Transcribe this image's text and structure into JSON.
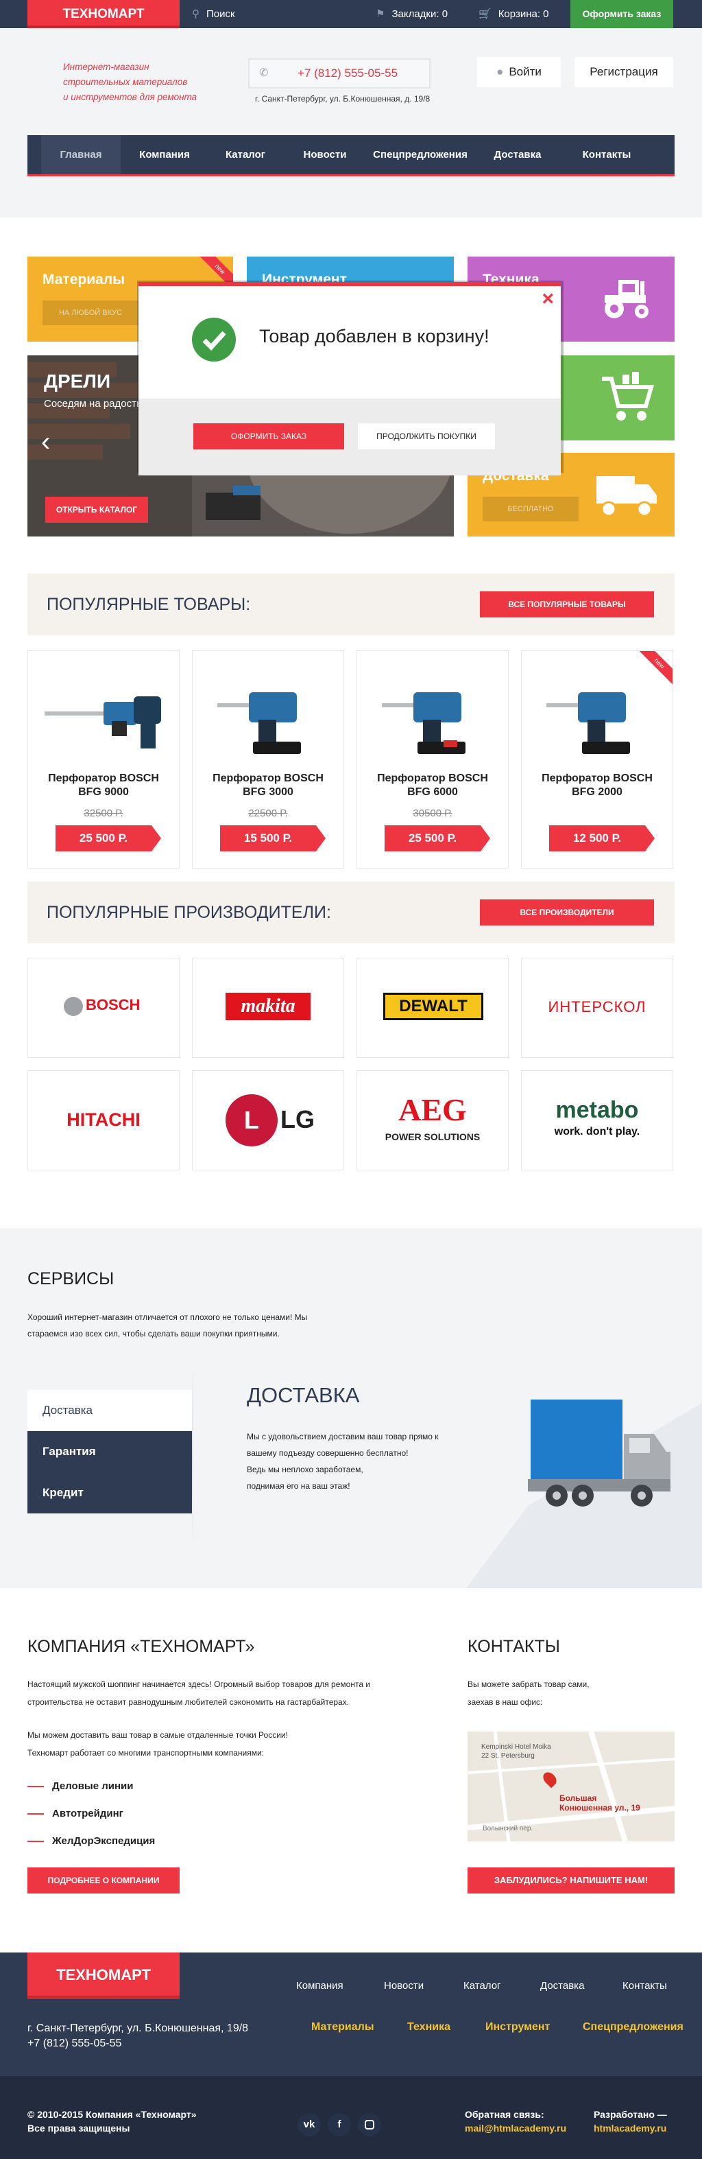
{
  "topbar": {
    "logo": "ТЕХНОМАРТ",
    "search": "Поиск",
    "bookmarks": "Закладки: 0",
    "cart": "Корзина: 0",
    "order": "Оформить заказ"
  },
  "header": {
    "slogan": [
      "Интернет-магазин",
      "строительных материалов",
      "и инструментов для ремонта"
    ],
    "phone": "+7 (812) 555-05-55",
    "address": "г. Санкт-Петербург, ул. Б.Конюшенная, д. 19/8",
    "login": "Войти",
    "register": "Регистрация"
  },
  "nav": [
    "Главная",
    "Компания",
    "Каталог",
    "Новости",
    "Спецпредложения",
    "Доставка",
    "Контакты"
  ],
  "tiles": {
    "materials": {
      "title": "Материалы",
      "button": "НА ЛЮБОЙ ВКУС",
      "ribbon": "new"
    },
    "instruments": {
      "title": "Инструмент"
    },
    "tech": {
      "title": "Техника"
    },
    "delivery": {
      "title": "Доставка",
      "button": "БЕСПЛАТНО"
    },
    "slider": {
      "title": "ДРЕЛИ",
      "subtitle": "Соседям на радость!",
      "button": "ОТКРЫТЬ КАТАЛОГ"
    }
  },
  "modal": {
    "message": "Товар добавлен в корзину!",
    "checkout": "ОФОРМИТЬ ЗАКАЗ",
    "continue": "ПРОДОЛЖИТЬ ПОКУПКИ"
  },
  "popular": {
    "title": "ПОПУЛЯРНЫЕ ТОВАРЫ:",
    "button": "ВСЕ ПОПУЛЯРНЫЕ ТОВАРЫ",
    "products": [
      {
        "name1": "Перфоратор BOSCH",
        "name2": "BFG 9000",
        "old": "32500 Р.",
        "price": "25 500 Р."
      },
      {
        "name1": "Перфоратор BOSCH",
        "name2": "BFG 3000",
        "old": "22500 Р.",
        "price": "15 500 Р."
      },
      {
        "name1": "Перфоратор BOSCH",
        "name2": "BFG 6000",
        "old": "30500 Р.",
        "price": "25 500 Р."
      },
      {
        "name1": "Перфоратор BOSCH",
        "name2": "BFG 2000",
        "old": "",
        "price": "12 500 Р.",
        "ribbon": "new"
      }
    ]
  },
  "brands": {
    "title": "ПОПУЛЯРНЫЕ ПРОИЗВОДИТЕЛИ:",
    "button": "ВСЕ ПРОИЗВОДИТЕЛИ",
    "items": [
      "BOSCH",
      "makita",
      "DEWALT",
      "ИНТЕРСКОЛ",
      "HITACHI",
      "LG",
      "AEG",
      "POWER SOLUTIONS",
      "metabo",
      "work. don't play."
    ]
  },
  "services": {
    "title": "СЕРВИСЫ",
    "text1": "Хороший интернет-магазин отличается от плохого не только ценами! Мы",
    "text2": "стараемся изо всех сил, чтобы сделать ваши покупки приятными.",
    "tabs": [
      "Доставка",
      "Гарантия",
      "Кредит"
    ],
    "delivery_title": "ДОСТАВКА",
    "delivery_text": [
      "Мы с удовольствием доставим ваш товар прямо к",
      "вашему подъезду совершенно бесплатно!",
      "Ведь мы неплохо заработаем,",
      "поднимая его на ваш этаж!"
    ]
  },
  "company": {
    "title": "КОМПАНИЯ «ТЕХНОМАРТ»",
    "p1": [
      "Настоящий мужской шоппинг начинается здесь! Огромный выбор товаров для ремонта и",
      "строительства не оставит равнодушным любителей сэкономить на гастарбайтерах."
    ],
    "p2": [
      "Мы можем доставить ваш товар в самые отдаленные точки России!",
      "Техномарт работает со многими транспортными компаниями:"
    ],
    "list": [
      "Деловые линии",
      "Автотрейдинг",
      "ЖелДорЭкспедиция"
    ],
    "button": "ПОДРОБНЕЕ О КОМПАНИИ"
  },
  "contacts": {
    "title": "КОНТАКТЫ",
    "text": [
      "Вы можете забрать товар сами,",
      "заехав в наш офис:"
    ],
    "map_hotel": [
      "Kempinski Hotel Moika",
      "22 St. Petersburg"
    ],
    "map_pin": [
      "Большая",
      "Конюшенная ул., 19"
    ],
    "map_street": "Волынский пер.",
    "button": "ЗАБЛУДИЛИСЬ? НАПИШИТЕ НАМ!"
  },
  "footer": {
    "logo": "ТЕХНОМАРТ",
    "links": [
      "Компания",
      "Новости",
      "Каталог",
      "Доставка",
      "Контакты"
    ],
    "categories": [
      "Материалы",
      "Техника",
      "Инструмент",
      "Спецпредложения"
    ],
    "address": "г. Санкт-Петербург, ул. Б.Конюшенная, 19/8",
    "phone": "+7 (812) 555-05-55",
    "copyright1": "© 2010-2015 Компания «Техномарт»",
    "copyright2": "Все права защищены",
    "social": [
      "vk",
      "f",
      "ig"
    ],
    "feedback_label": "Обратная связь:",
    "feedback_email": "mail@htmlacademy.ru",
    "dev_label": "Разработано —",
    "dev_link": "htmlacademy.ru"
  },
  "colors": {
    "brand": "#ee3643",
    "navy": "#2f3b52",
    "green": "#3f9d45",
    "yellow": "#f4b22c",
    "blue": "#35a5dc",
    "violet": "#c266c9",
    "lime": "#73c056"
  }
}
